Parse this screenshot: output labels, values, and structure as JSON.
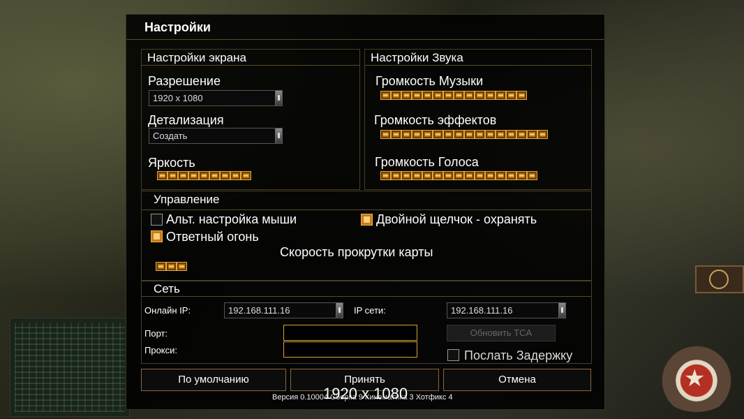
{
  "title": "Настройки",
  "screen": {
    "header": "Настройки экрана",
    "resolution_label": "Разрешение",
    "resolution_value": "1920 x 1080",
    "detail_label": "Детализация",
    "detail_value": "Создать",
    "brightness_label": "Яркость",
    "brightness_level": 9
  },
  "sound": {
    "header": "Настройки Звука",
    "music_label": "Громкость Музыки",
    "music_level": 14,
    "effects_label": "Громкость эффектов",
    "effects_level": 16,
    "voice_label": "Громкость Голоса",
    "voice_level": 15
  },
  "controls": {
    "header": "Управление",
    "alt_mouse_label": "Альт. настройка мыши",
    "alt_mouse_checked": false,
    "double_click_label": "Двойной щелчок - охранять",
    "double_click_checked": true,
    "return_fire_label": "Ответный огонь",
    "return_fire_checked": true,
    "scroll_speed_label": "Скорость прокрутки карты",
    "scroll_speed_level": 3
  },
  "network": {
    "header": "Сеть",
    "online_ip_label": "Онлайн IP:",
    "online_ip_value": "192.168.111.16",
    "lan_ip_label": "IP сети:",
    "lan_ip_value": "192.168.111.16",
    "port_label": "Порт:",
    "port_value": "",
    "proxy_label": "Прокси:",
    "proxy_value": "",
    "update_tca_label": "Обновить TCA",
    "send_delay_label": "Послать Задержку",
    "send_delay_checked": false
  },
  "buttons": {
    "default_label": "По умолчанию",
    "accept_label": "Принять",
    "cancel_label": "Отмена"
  },
  "version_text": "Версия 0.10004 Сборка 9 Кинематика 3 Хотфикс 4",
  "overlay_text": "1920 x 1080",
  "colors": {
    "accent": "#c97a16",
    "field_border": "#d6a43a",
    "button_border": "#8a6a3a"
  }
}
